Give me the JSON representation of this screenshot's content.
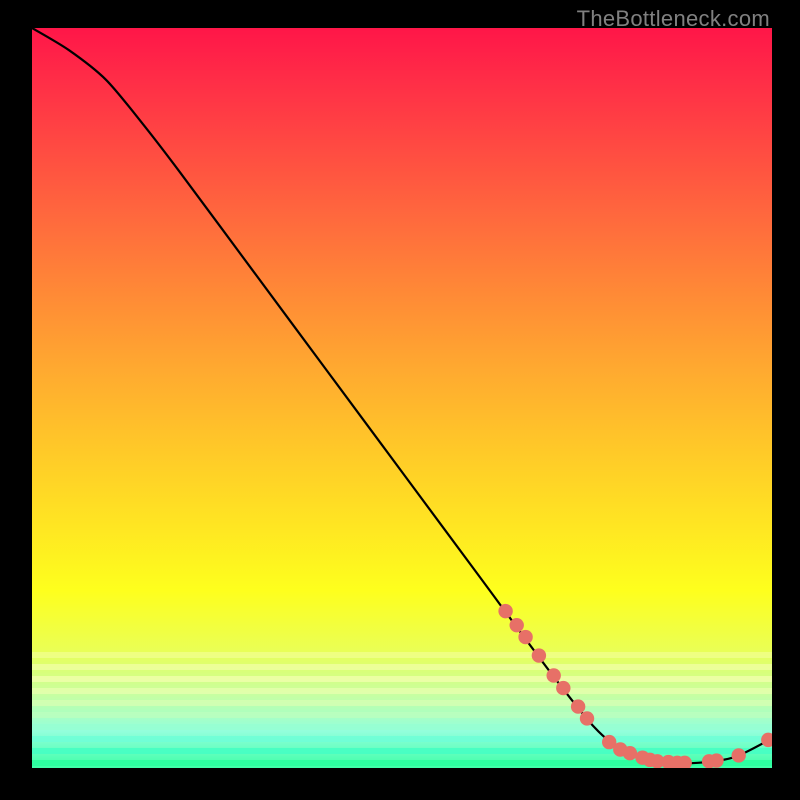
{
  "watermark": "TheBottleneck.com",
  "chart_data": {
    "type": "line",
    "title": "",
    "xlabel": "",
    "ylabel": "",
    "xlim": [
      0,
      100
    ],
    "ylim": [
      0,
      100
    ],
    "grid": false,
    "legend": false,
    "curve": [
      {
        "x": 0,
        "y": 100
      },
      {
        "x": 5,
        "y": 97
      },
      {
        "x": 10,
        "y": 93
      },
      {
        "x": 15,
        "y": 87
      },
      {
        "x": 20,
        "y": 80.5
      },
      {
        "x": 30,
        "y": 67
      },
      {
        "x": 40,
        "y": 53.5
      },
      {
        "x": 50,
        "y": 40
      },
      {
        "x": 60,
        "y": 26.5
      },
      {
        "x": 70,
        "y": 13
      },
      {
        "x": 76,
        "y": 5.5
      },
      {
        "x": 80,
        "y": 2.3
      },
      {
        "x": 85,
        "y": 0.8
      },
      {
        "x": 90,
        "y": 0.7
      },
      {
        "x": 95,
        "y": 1.5
      },
      {
        "x": 100,
        "y": 4
      }
    ],
    "markers": [
      {
        "x": 64.0,
        "y": 21.2
      },
      {
        "x": 65.5,
        "y": 19.3
      },
      {
        "x": 66.7,
        "y": 17.7
      },
      {
        "x": 68.5,
        "y": 15.2
      },
      {
        "x": 70.5,
        "y": 12.5
      },
      {
        "x": 71.8,
        "y": 10.8
      },
      {
        "x": 73.8,
        "y": 8.3
      },
      {
        "x": 75.0,
        "y": 6.7
      },
      {
        "x": 78.0,
        "y": 3.5
      },
      {
        "x": 79.5,
        "y": 2.5
      },
      {
        "x": 80.8,
        "y": 2.0
      },
      {
        "x": 82.5,
        "y": 1.4
      },
      {
        "x": 83.5,
        "y": 1.1
      },
      {
        "x": 84.5,
        "y": 0.9
      },
      {
        "x": 86.0,
        "y": 0.8
      },
      {
        "x": 87.2,
        "y": 0.7
      },
      {
        "x": 88.2,
        "y": 0.7
      },
      {
        "x": 91.5,
        "y": 0.9
      },
      {
        "x": 92.5,
        "y": 1.0
      },
      {
        "x": 95.5,
        "y": 1.7
      },
      {
        "x": 99.5,
        "y": 3.8
      }
    ],
    "marker_color": "#e77067",
    "curve_color": "#000000",
    "curve_width": 2.2,
    "marker_radius": 7.2
  }
}
